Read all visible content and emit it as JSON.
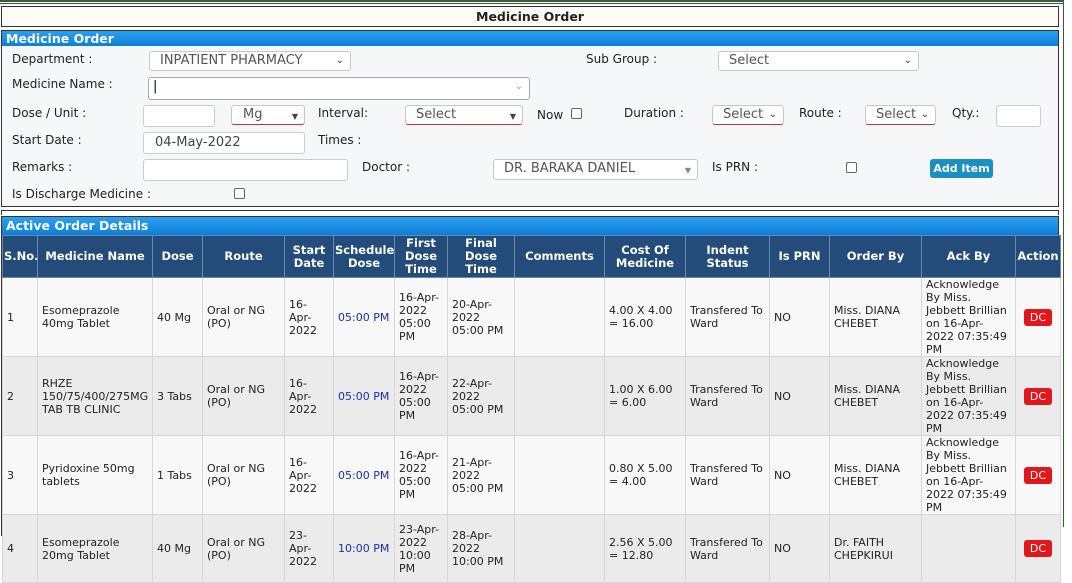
{
  "page_title": "Medicine Order",
  "form": {
    "header": "Medicine Order",
    "department_label": "Department :",
    "department_value": "INPATIENT PHARMACY",
    "subgroup_label": "Sub Group :",
    "subgroup_value": "Select",
    "medicine_label": "Medicine Name :",
    "medicine_value": "|",
    "dose_label": "Dose / Unit :",
    "unit_value": "Mg",
    "interval_label": "Interval:",
    "interval_value": "Select",
    "now_label": "Now",
    "duration_label": "Duration :",
    "duration_value": "Select",
    "route_label": "Route :",
    "route_value": "Select",
    "qty_label": "Qty.:",
    "start_label": "Start Date :",
    "start_value": "04-May-2022",
    "times_label": "Times :",
    "remarks_label": "Remarks :",
    "doctor_label": "Doctor :",
    "doctor_value": "DR. BARAKA DANIEL",
    "prn_label": "Is PRN :",
    "add_item": "Add Item",
    "discharge_label": "Is Discharge Medicine :"
  },
  "orders": {
    "header": "Active Order Details",
    "columns": [
      "S.No.",
      "Medicine Name",
      "Dose",
      "Route",
      "Start Date",
      "Schedule Dose",
      "First Dose Time",
      "Final Dose Time",
      "Comments",
      "Cost Of Medicine",
      "Indent Status",
      "Is PRN",
      "Order By",
      "Ack By",
      "Action"
    ],
    "rows": [
      {
        "sno": "1",
        "name": "Esomeprazole 40mg Tablet",
        "dose": "40 Mg",
        "route": "Oral or NG (PO)",
        "start": "16-Apr-2022",
        "schedule": "05:00 PM",
        "first": "16-Apr-2022 05:00 PM",
        "final": "20-Apr-2022 05:00 PM",
        "comments": "",
        "cost": "4.00 X 4.00 = 16.00",
        "status": "Transfered To Ward",
        "prn": "NO",
        "order_by": "Miss. DIANA CHEBET",
        "ack_by": "Acknowledge By Miss. Jebbett Brillian on 16-Apr-2022 07:35:49 PM",
        "action": "DC"
      },
      {
        "sno": "2",
        "name": "RHZE 150/75/400/275MG TAB TB CLINIC",
        "dose": "3 Tabs",
        "route": "Oral or NG (PO)",
        "start": "16-Apr-2022",
        "schedule": "05:00 PM",
        "first": "16-Apr-2022 05:00 PM",
        "final": "22-Apr-2022 05:00 PM",
        "comments": "",
        "cost": "1.00 X 6.00 = 6.00",
        "status": "Transfered To Ward",
        "prn": "NO",
        "order_by": "Miss. DIANA CHEBET",
        "ack_by": "Acknowledge By Miss. Jebbett Brillian on 16-Apr-2022 07:35:49 PM",
        "action": "DC"
      },
      {
        "sno": "3",
        "name": "Pyridoxine 50mg tablets",
        "dose": "1 Tabs",
        "route": "Oral or NG (PO)",
        "start": "16-Apr-2022",
        "schedule": "05:00 PM",
        "first": "16-Apr-2022 05:00 PM",
        "final": "21-Apr-2022 05:00 PM",
        "comments": "",
        "cost": "0.80 X 5.00 = 4.00",
        "status": "Transfered To Ward",
        "prn": "NO",
        "order_by": "Miss. DIANA CHEBET",
        "ack_by": "Acknowledge By Miss. Jebbett Brillian on 16-Apr-2022 07:35:49 PM",
        "action": "DC"
      },
      {
        "sno": "4",
        "name": "Esomeprazole 20mg Tablet",
        "dose": "40 Mg",
        "route": "Oral or NG (PO)",
        "start": "23-Apr-2022",
        "schedule": "10:00 PM",
        "first": "23-Apr-2022 10:00 PM",
        "final": "28-Apr-2022 10:00 PM",
        "comments": "",
        "cost": "2.56 X 5.00 = 12.80",
        "status": "Transfered To Ward",
        "prn": "NO",
        "order_by": "Dr. FAITH CHEPKIRUI",
        "ack_by": "",
        "action": "DC"
      }
    ]
  }
}
